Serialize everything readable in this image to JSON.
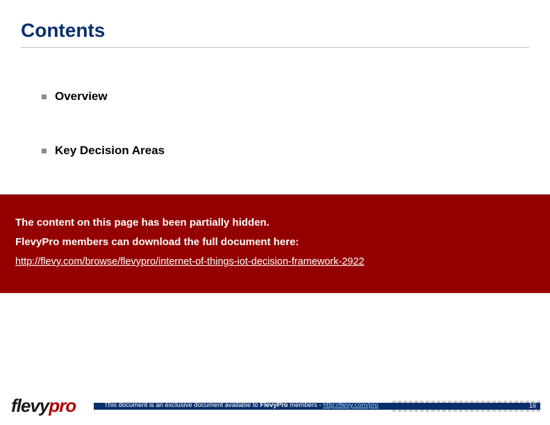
{
  "header": {
    "title": "Contents"
  },
  "bullets": [
    "Overview",
    "Key Decision Areas"
  ],
  "overlay": {
    "line1": "The content on this page has been partially hidden.",
    "line2": "FlevyPro members can download the full document here:",
    "link_text": "http://flevy.com/browse/flevypro/internet-of-things-iot-decision-framework-2922",
    "link_href": "http://flevy.com/browse/flevypro/internet-of-things-iot-decision-framework-2922"
  },
  "footer": {
    "logo_part1": "flevy",
    "logo_part2": "pro",
    "text_prefix": "This document is an exclusive document available to ",
    "text_brand": "FlevyPro",
    "text_suffix": " members - ",
    "link_text": "http://flevy.com/pro",
    "link_href": "http://flevy.com/pro",
    "page_number": "16"
  }
}
